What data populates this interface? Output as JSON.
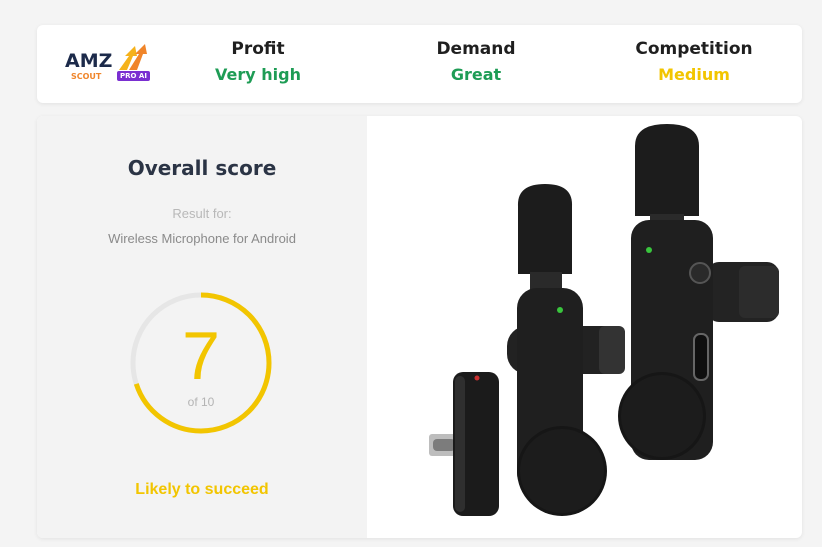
{
  "logo": {
    "brand": "AMZ",
    "sub": "SCOUT",
    "badge": "PRO AI"
  },
  "metrics": [
    {
      "label": "Profit",
      "value": "Very high",
      "color": "#1e9c55"
    },
    {
      "label": "Demand",
      "value": "Great",
      "color": "#1e9c55"
    },
    {
      "label": "Competition",
      "value": "Medium",
      "color": "#f2c500"
    }
  ],
  "score": {
    "title": "Overall score",
    "result_for": "Result for:",
    "product_name": "Wireless Microphone for Android",
    "value": "7",
    "of_text": "of 10",
    "fraction": 0.7,
    "verdict": "Likely to succeed",
    "accent": "#f2c500"
  },
  "product_image": {
    "icon": "wireless-microphone-product-image"
  }
}
